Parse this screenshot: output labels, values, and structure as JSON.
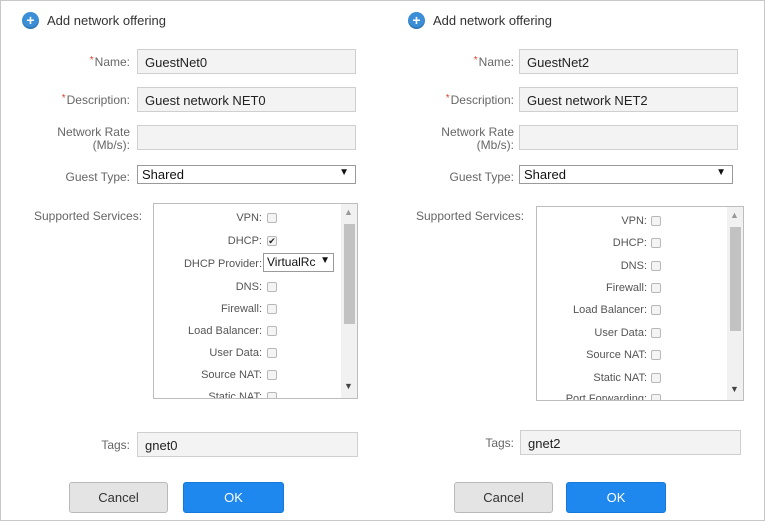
{
  "dialogs": [
    {
      "title": "Add network offering",
      "name_label": "Name:",
      "name_value": "GuestNet0",
      "description_label": "Description:",
      "description_value": "Guest network NET0",
      "network_rate_label_line1": "Network Rate",
      "network_rate_label_line2": "(Mb/s):",
      "network_rate_value": "",
      "guest_type_label": "Guest Type:",
      "guest_type_value": "Shared",
      "supported_services_label": "Supported Services:",
      "services": [
        {
          "label": "VPN:",
          "kind": "checkbox",
          "checked": false
        },
        {
          "label": "DHCP:",
          "kind": "checkbox",
          "checked": true
        },
        {
          "label": "DHCP Provider:",
          "kind": "select",
          "value": "VirtualRc"
        },
        {
          "label": "DNS:",
          "kind": "checkbox",
          "checked": false
        },
        {
          "label": "Firewall:",
          "kind": "checkbox",
          "checked": false
        },
        {
          "label": "Load Balancer:",
          "kind": "checkbox",
          "checked": false
        },
        {
          "label": "User Data:",
          "kind": "checkbox",
          "checked": false
        },
        {
          "label": "Source NAT:",
          "kind": "checkbox",
          "checked": false
        },
        {
          "label": "Static NAT:",
          "kind": "checkbox",
          "checked": false
        }
      ],
      "tags_label": "Tags:",
      "tags_value": "gnet0",
      "cancel_label": "Cancel",
      "ok_label": "OK"
    },
    {
      "title": "Add network offering",
      "name_label": "Name:",
      "name_value": "GuestNet2",
      "description_label": "Description:",
      "description_value": "Guest network NET2",
      "network_rate_label_line1": "Network Rate",
      "network_rate_label_line2": "(Mb/s):",
      "network_rate_value": "",
      "guest_type_label": "Guest Type:",
      "guest_type_value": "Shared",
      "supported_services_label": "Supported Services:",
      "services": [
        {
          "label": "VPN:",
          "kind": "checkbox",
          "checked": false
        },
        {
          "label": "DHCP:",
          "kind": "checkbox",
          "checked": false
        },
        {
          "label": "DNS:",
          "kind": "checkbox",
          "checked": false
        },
        {
          "label": "Firewall:",
          "kind": "checkbox",
          "checked": false
        },
        {
          "label": "Load Balancer:",
          "kind": "checkbox",
          "checked": false
        },
        {
          "label": "User Data:",
          "kind": "checkbox",
          "checked": false
        },
        {
          "label": "Source NAT:",
          "kind": "checkbox",
          "checked": false
        },
        {
          "label": "Static NAT:",
          "kind": "checkbox",
          "checked": false
        },
        {
          "label": "Port Forwarding:",
          "kind": "checkbox",
          "checked": false
        }
      ],
      "tags_label": "Tags:",
      "tags_value": "gnet2",
      "cancel_label": "Cancel",
      "ok_label": "OK"
    }
  ],
  "icons": {
    "add": "plus-circle-icon",
    "dropdown": "caret-down-icon",
    "scroll_up": "scroll-up-icon",
    "scroll_down": "scroll-down-icon"
  },
  "colors": {
    "accent": "#1e88ee",
    "title_icon": "#3b8fd6",
    "required": "#dd4433"
  }
}
